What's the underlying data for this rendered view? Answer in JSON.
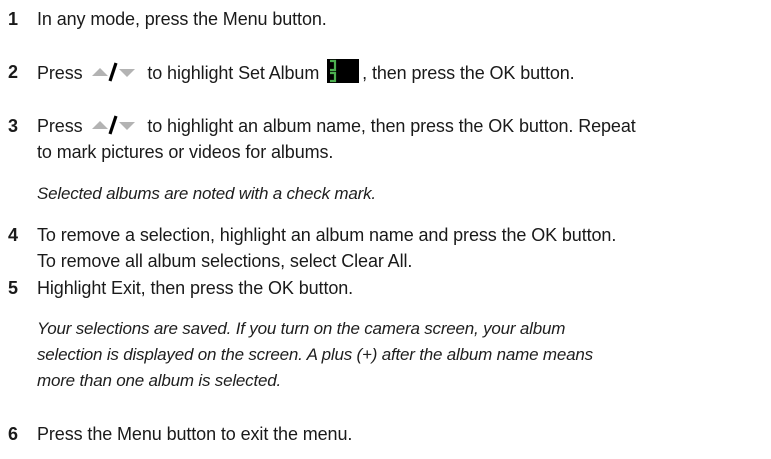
{
  "steps": [
    {
      "number": "1",
      "lines": [
        "In any mode, press the Menu button."
      ]
    },
    {
      "number": "2",
      "before_icon": "Press",
      "mid_text": "to highlight Set Album",
      "after_icon": ", then press the OK button."
    },
    {
      "number": "3",
      "before_icon": "Press",
      "after_icon": "to highlight an album name, then press the OK button. Repeat",
      "line2": "to mark pictures or videos for albums.",
      "note": "Selected albums are noted with a check mark."
    },
    {
      "number": "4",
      "lines": [
        "To remove a selection, highlight an album name and press the OK button.",
        "To remove all album selections, select Clear All."
      ]
    },
    {
      "number": "5",
      "lines": [
        "Highlight Exit, then press the OK button."
      ],
      "note_lines": [
        "Your selections are saved. If you turn on the camera screen, your album",
        "selection is displayed on the screen. A plus (+) after the album name means",
        "more than one album is selected."
      ]
    },
    {
      "number": "6",
      "lines": [
        "Press the Menu button to exit the menu."
      ]
    }
  ],
  "icons": {
    "up_down": "up-down-arrow-icon",
    "album": "set-album-icon"
  },
  "colors": {
    "text": "#1a1a1a",
    "arrow": "#b3b3b3",
    "slash": "#000000"
  }
}
